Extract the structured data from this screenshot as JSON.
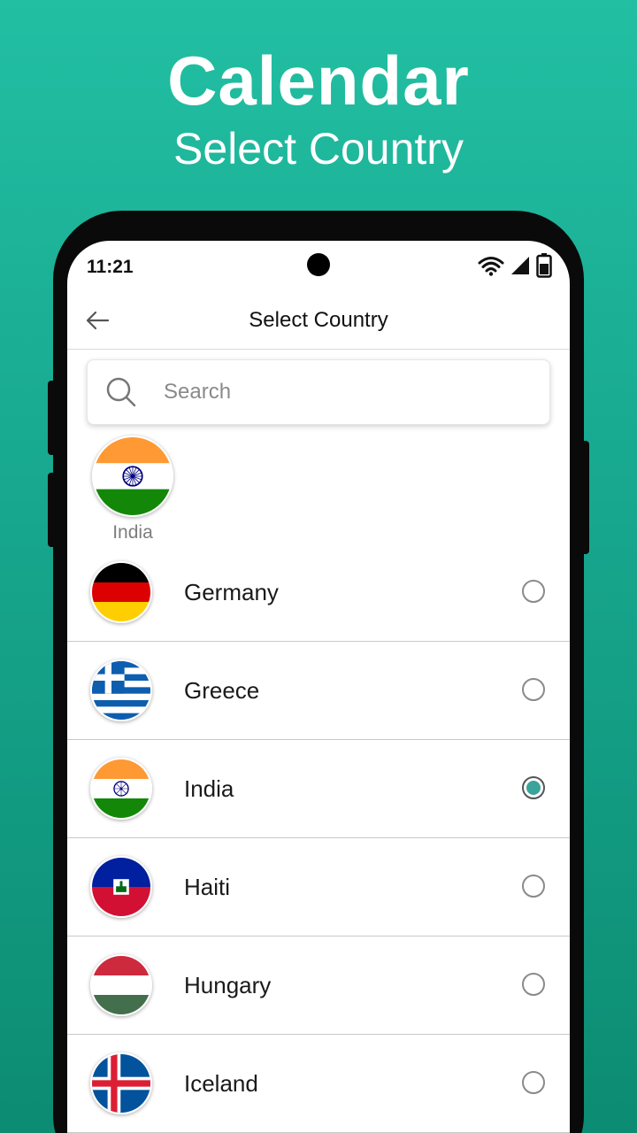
{
  "promo": {
    "title": "Calendar",
    "subtitle": "Select Country"
  },
  "status_bar": {
    "time": "11:21",
    "icons": [
      "wifi-icon",
      "signal-icon",
      "battery-icon"
    ]
  },
  "app_bar": {
    "back_icon": "arrow-left-icon",
    "title": "Select Country"
  },
  "search": {
    "placeholder": "Search",
    "value": ""
  },
  "selected_country": {
    "label": "India",
    "flag": "india"
  },
  "countries": [
    {
      "name": "Germany",
      "flag": "germany",
      "selected": false
    },
    {
      "name": "Greece",
      "flag": "greece",
      "selected": false
    },
    {
      "name": "India",
      "flag": "india",
      "selected": true
    },
    {
      "name": "Haiti",
      "flag": "haiti",
      "selected": false
    },
    {
      "name": "Hungary",
      "flag": "hungary",
      "selected": false
    },
    {
      "name": "Iceland",
      "flag": "iceland",
      "selected": false
    }
  ],
  "colors": {
    "accent": "#3aa49a",
    "background_top": "#22bfa3",
    "background_bottom": "#0c8c72"
  }
}
